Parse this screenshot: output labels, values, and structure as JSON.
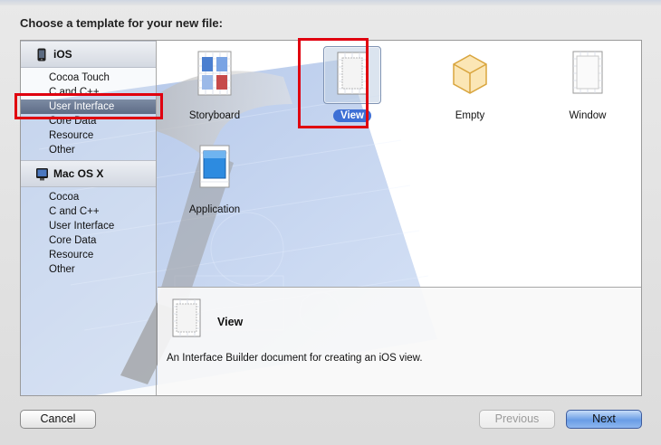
{
  "dialog": {
    "title": "Choose a template for your new file:"
  },
  "sidebar": {
    "groups": [
      {
        "label": "iOS",
        "icon": "iphone-icon",
        "items": [
          "Cocoa Touch",
          "C and C++",
          "User Interface",
          "Core Data",
          "Resource",
          "Other"
        ],
        "selected_index": 2
      },
      {
        "label": "Mac OS X",
        "icon": "apple-logo-icon",
        "items": [
          "Cocoa",
          "C and C++",
          "User Interface",
          "Core Data",
          "Resource",
          "Other"
        ]
      }
    ]
  },
  "templates": [
    {
      "label": "Storyboard",
      "icon": "storyboard-icon"
    },
    {
      "label": "View",
      "icon": "view-document-icon",
      "selected": true
    },
    {
      "label": "Empty",
      "icon": "empty-cube-icon"
    },
    {
      "label": "Window",
      "icon": "window-document-icon"
    },
    {
      "label": "Application",
      "icon": "application-document-icon"
    }
  ],
  "detail": {
    "title": "View",
    "description": "An Interface Builder document for creating an iOS view."
  },
  "buttons": {
    "cancel": "Cancel",
    "previous": "Previous",
    "next": "Next"
  },
  "colors": {
    "highlight": "#e0000f",
    "selection": "#3d6fd5",
    "sidebar_selection": "#5d6c86"
  }
}
